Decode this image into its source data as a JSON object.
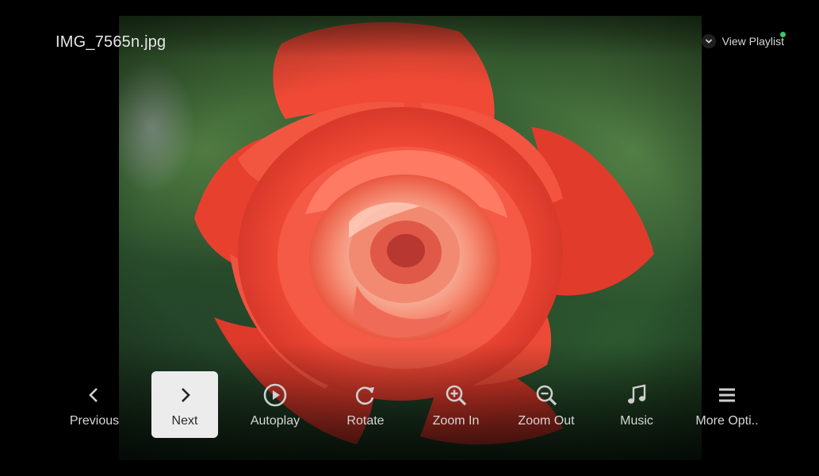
{
  "file": {
    "name": "IMG_7565n.jpg"
  },
  "playlist": {
    "label": "View Playlist",
    "icon": "chevron-down-icon",
    "status_color": "#3ec46d"
  },
  "controls": [
    {
      "label": "Previous",
      "icon": "chevron-left-icon",
      "active": false
    },
    {
      "label": "Next",
      "icon": "chevron-right-icon",
      "active": true
    },
    {
      "label": "Autoplay",
      "icon": "play-circle-icon",
      "active": false
    },
    {
      "label": "Rotate",
      "icon": "rotate-icon",
      "active": false
    },
    {
      "label": "Zoom In",
      "icon": "zoom-in-icon",
      "active": false
    },
    {
      "label": "Zoom Out",
      "icon": "zoom-out-icon",
      "active": false
    },
    {
      "label": "Music",
      "icon": "music-note-icon",
      "active": false
    },
    {
      "label": "More Opti..",
      "icon": "menu-icon",
      "active": false
    }
  ],
  "photo": {
    "subject": "red-rose-photo"
  },
  "colors": {
    "highlight": "#ececec",
    "text": "#d6d6d6",
    "background": "#000000"
  }
}
